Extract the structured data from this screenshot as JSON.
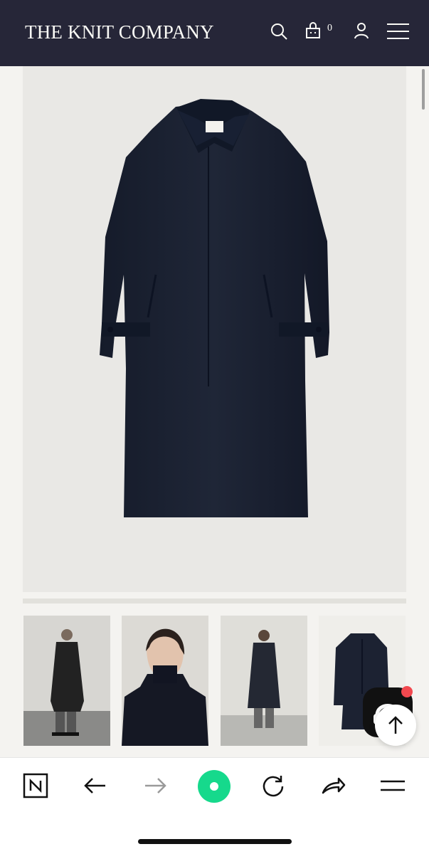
{
  "header": {
    "logo": "THE KNIT COMPANY",
    "cart_count": "0"
  },
  "icons": {
    "search": "search-icon",
    "cart": "shopping-bag-icon",
    "user": "user-icon",
    "menu": "hamburger-menu-icon",
    "chat": "chat-headset-icon",
    "top": "arrow-up-icon"
  },
  "colors": {
    "header_bg": "#262638",
    "accent_green": "#16d98c",
    "notification": "#f2484f",
    "coat": "#1a2030"
  },
  "gallery": {
    "main_image": "navy long wool coat product image",
    "thumbnails": [
      "model wearing navy coat full length",
      "model portrait with high collar",
      "back view of model in coat",
      "navy coat product thumbnail"
    ]
  },
  "browser_bar": {
    "items": [
      "N",
      "back",
      "forward",
      "home",
      "reload",
      "share",
      "menu"
    ]
  }
}
